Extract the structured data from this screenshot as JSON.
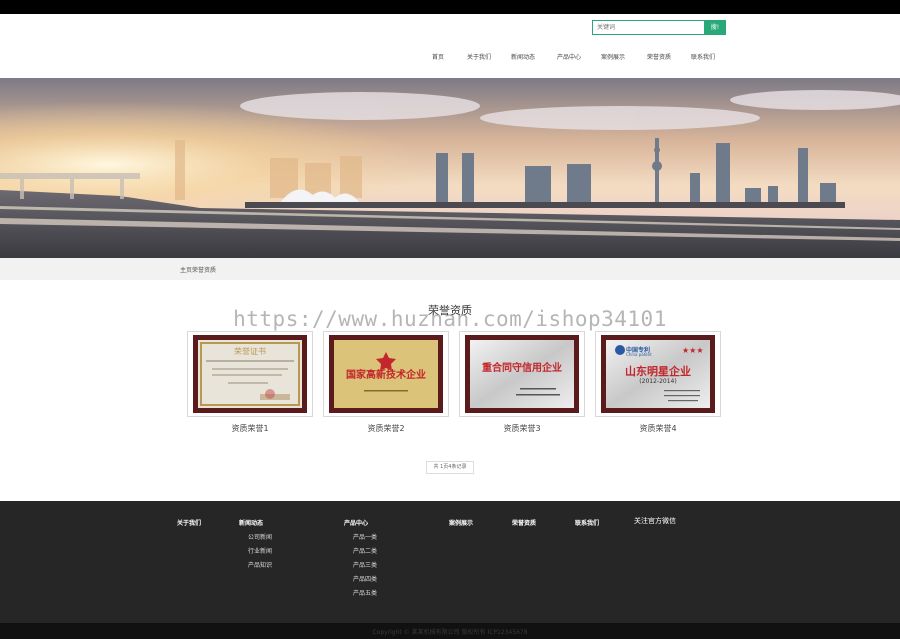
{
  "search": {
    "placeholder": "关键词",
    "button_label": "搜!"
  },
  "nav": [
    "首页",
    "关于我们",
    "新闻动态",
    "产品中心",
    "案例展示",
    "荣誉资质",
    "联系我们"
  ],
  "breadcrumb": "主页荣誉资质",
  "watermark": "https://www.huzhan.com/ishop34101",
  "section_title": "荣誉资质",
  "certificates": [
    {
      "label": "资质荣誉1",
      "text": "荣誉证书"
    },
    {
      "label": "资质荣誉2",
      "text": "国家高新技术企业"
    },
    {
      "label": "资质荣誉3",
      "text": "重合同守信用企业"
    },
    {
      "label": "资质荣誉4",
      "text": "山东明星企业",
      "year": "(2012-2014)",
      "header": "中国专利",
      "sub": "China patent"
    }
  ],
  "pager": "共 1页4条记录",
  "footer": {
    "columns": [
      {
        "title": "关于我们",
        "items": []
      },
      {
        "title": "新闻动态",
        "items": [
          "公司新闻",
          "行业新闻",
          "产品知识"
        ]
      },
      {
        "title": "产品中心",
        "items": [
          "产品一类",
          "产品二类",
          "产品三类",
          "产品四类",
          "产品五类"
        ]
      },
      {
        "title": "案例展示",
        "items": []
      },
      {
        "title": "荣誉资质",
        "items": []
      },
      {
        "title": "联系我们",
        "items": []
      }
    ],
    "wechat": "关注官方微信",
    "copyright": "Copyright © 某某机械有限公司 版权所有  ICP12345678"
  },
  "colors": {
    "accent": "#29a878",
    "footer_bg": "#262626",
    "frame": "#5b1a1c"
  }
}
